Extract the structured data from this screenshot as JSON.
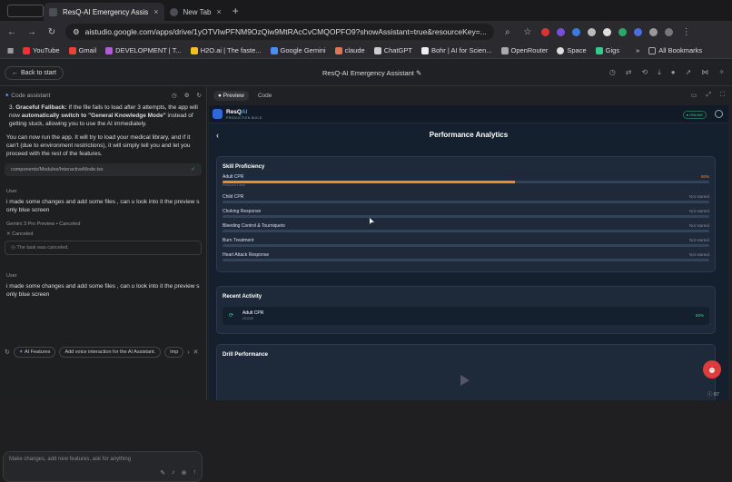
{
  "browser": {
    "tabs": [
      {
        "label": "ResQ-AI Emergency Assis",
        "active": true
      },
      {
        "label": "New Tab",
        "active": false
      }
    ],
    "url": "aistudio.google.com/apps/drive/1yOTVIwPFNM9OzQiw9MtRAcCvCMQOPFO9?showAssistant=true&resourceKey=...",
    "bookmarks": [
      "YouTube",
      "Gmail",
      "DEVELOPMENT | T...",
      "H2O.ai | The faste...",
      "Google Gemini",
      "claude",
      "ChatGPT",
      "Bohr | AI for Scien...",
      "OpenRouter",
      "Space",
      "Gigs"
    ],
    "all_bookmarks": "All Bookmarks"
  },
  "header": {
    "back_label": "Back to start",
    "title": "ResQ-AI Emergency Assistant"
  },
  "assistant": {
    "title": "Code assistant",
    "message1_bold1": "Graceful Fallback:",
    "message1_text": "If the file fails to load after 3 attempts, the app will now",
    "message1_bold2": "automatically switch to \"General Knowledge Mode\"",
    "message1_tail": "instead of getting stuck, allowing you to use the AI immediately.",
    "message2": "You can now run the app. It will try to load your medical library, and if it can't (due to environment restrictions), it will simply tell you and let you proceed with the rest of the features.",
    "file": "components/Modules/InteractiveMode.tsx",
    "user_label1": "User",
    "user_msg1": "i made some changes and add some files , can u look into it the preview s only blue screen",
    "model_label": "Gemini 3 Pro Preview",
    "model_status": "Canceled",
    "canceled": "Canceled",
    "task_canceled": "The task was canceled.",
    "user_label2": "User",
    "user_msg2": "i made some changes and add some files , can u look into it the preview s only blue screen",
    "chips": [
      "AI Features",
      "Add voice interaction for the AI Assistant.",
      "Imp"
    ],
    "input_placeholder": "Make changes, add new features, ask for anything"
  },
  "preview": {
    "tabs": [
      "Preview",
      "Code"
    ],
    "brand_prefix": "ResQ",
    "brand_ai": "AI",
    "brand_sub": "PRODUCTION BUILD",
    "status": "ONLINE",
    "page_title": "Performance Analytics",
    "skill_title": "Skill Proficiency",
    "skills": [
      {
        "name": "Adult CPR",
        "status": "60%",
        "progress": 0.6,
        "sub": "Practiced 1 time"
      },
      {
        "name": "Child CPR",
        "status": "Not started",
        "progress": 0
      },
      {
        "name": "Choking Response",
        "status": "Not started",
        "progress": 0
      },
      {
        "name": "Bleeding Control & Tourniquets",
        "status": "Not started",
        "progress": 0
      },
      {
        "name": "Burn Treatment",
        "status": "Not started",
        "progress": 0
      },
      {
        "name": "Heart Attack Response",
        "status": "Not started",
        "progress": 0
      }
    ],
    "activity_title": "Recent Activity",
    "activity": {
      "name": "Adult CPR",
      "date": "2/10/26",
      "score": "60%"
    },
    "drill_title": "Drill Performance",
    "zoom": "87"
  }
}
